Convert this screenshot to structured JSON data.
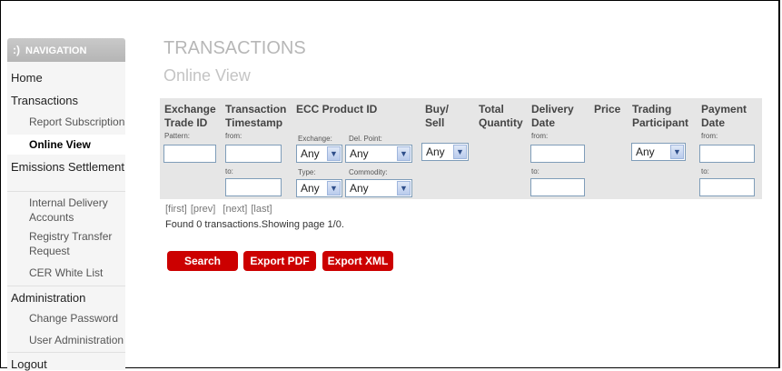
{
  "nav": {
    "header": "NAVIGATION",
    "items": [
      {
        "label": "Home"
      },
      {
        "label": "Transactions"
      },
      {
        "label": "Report Subscription"
      },
      {
        "label": "Online View"
      },
      {
        "label": "Emissions Settlement"
      },
      {
        "label": "Internal Delivery Accounts"
      },
      {
        "label": "Registry Transfer Request"
      },
      {
        "label": "CER White List"
      },
      {
        "label": "Administration"
      },
      {
        "label": "Change Password"
      },
      {
        "label": "User Administration"
      },
      {
        "label": "Logout"
      }
    ],
    "active_item": "Online View"
  },
  "page": {
    "title": "TRANSACTIONS",
    "subtitle": "Online View"
  },
  "filters": {
    "exchange_trade_id": {
      "header": "Exchange Trade ID",
      "sub": "Pattern:",
      "value": ""
    },
    "transaction_timestamp": {
      "header": "Transaction Timestamp",
      "from": "from:",
      "to": "to:",
      "from_value": "",
      "to_value": ""
    },
    "ecc_product_id": {
      "header": "ECC Product ID",
      "exchange_label": "Exchange:",
      "exchange_value": "Any",
      "del_point_label": "Del. Point:",
      "del_point_value": "Any",
      "type_label": "Type:",
      "type_value": "Any",
      "commodity_label": "Commodity:",
      "commodity_value": "Any"
    },
    "buy_sell": {
      "header": "Buy/ Sell",
      "value": "Any"
    },
    "total_quantity": {
      "header": "Total Quantity"
    },
    "delivery_date": {
      "header": "Delivery Date",
      "from": "from:",
      "to": "to:",
      "from_value": "",
      "to_value": ""
    },
    "price": {
      "header": "Price"
    },
    "trading_participant": {
      "header": "Trading Participant",
      "value": "Any"
    },
    "payment_date": {
      "header": "Payment Date",
      "from": "from:",
      "to": "to:",
      "from_value": "",
      "to_value": ""
    }
  },
  "pager": {
    "first": "[first]",
    "prev": "[prev]",
    "next": "[next]",
    "last": "[last]",
    "status": "Found 0 transactions.Showing page 1/0."
  },
  "buttons": {
    "search": "Search",
    "export_pdf": "Export PDF",
    "export_xml": "Export XML"
  },
  "colors": {
    "accent": "#cc0000",
    "filter_bg": "#e6e6e6",
    "sidebar_bg": "#f5f5f5"
  }
}
